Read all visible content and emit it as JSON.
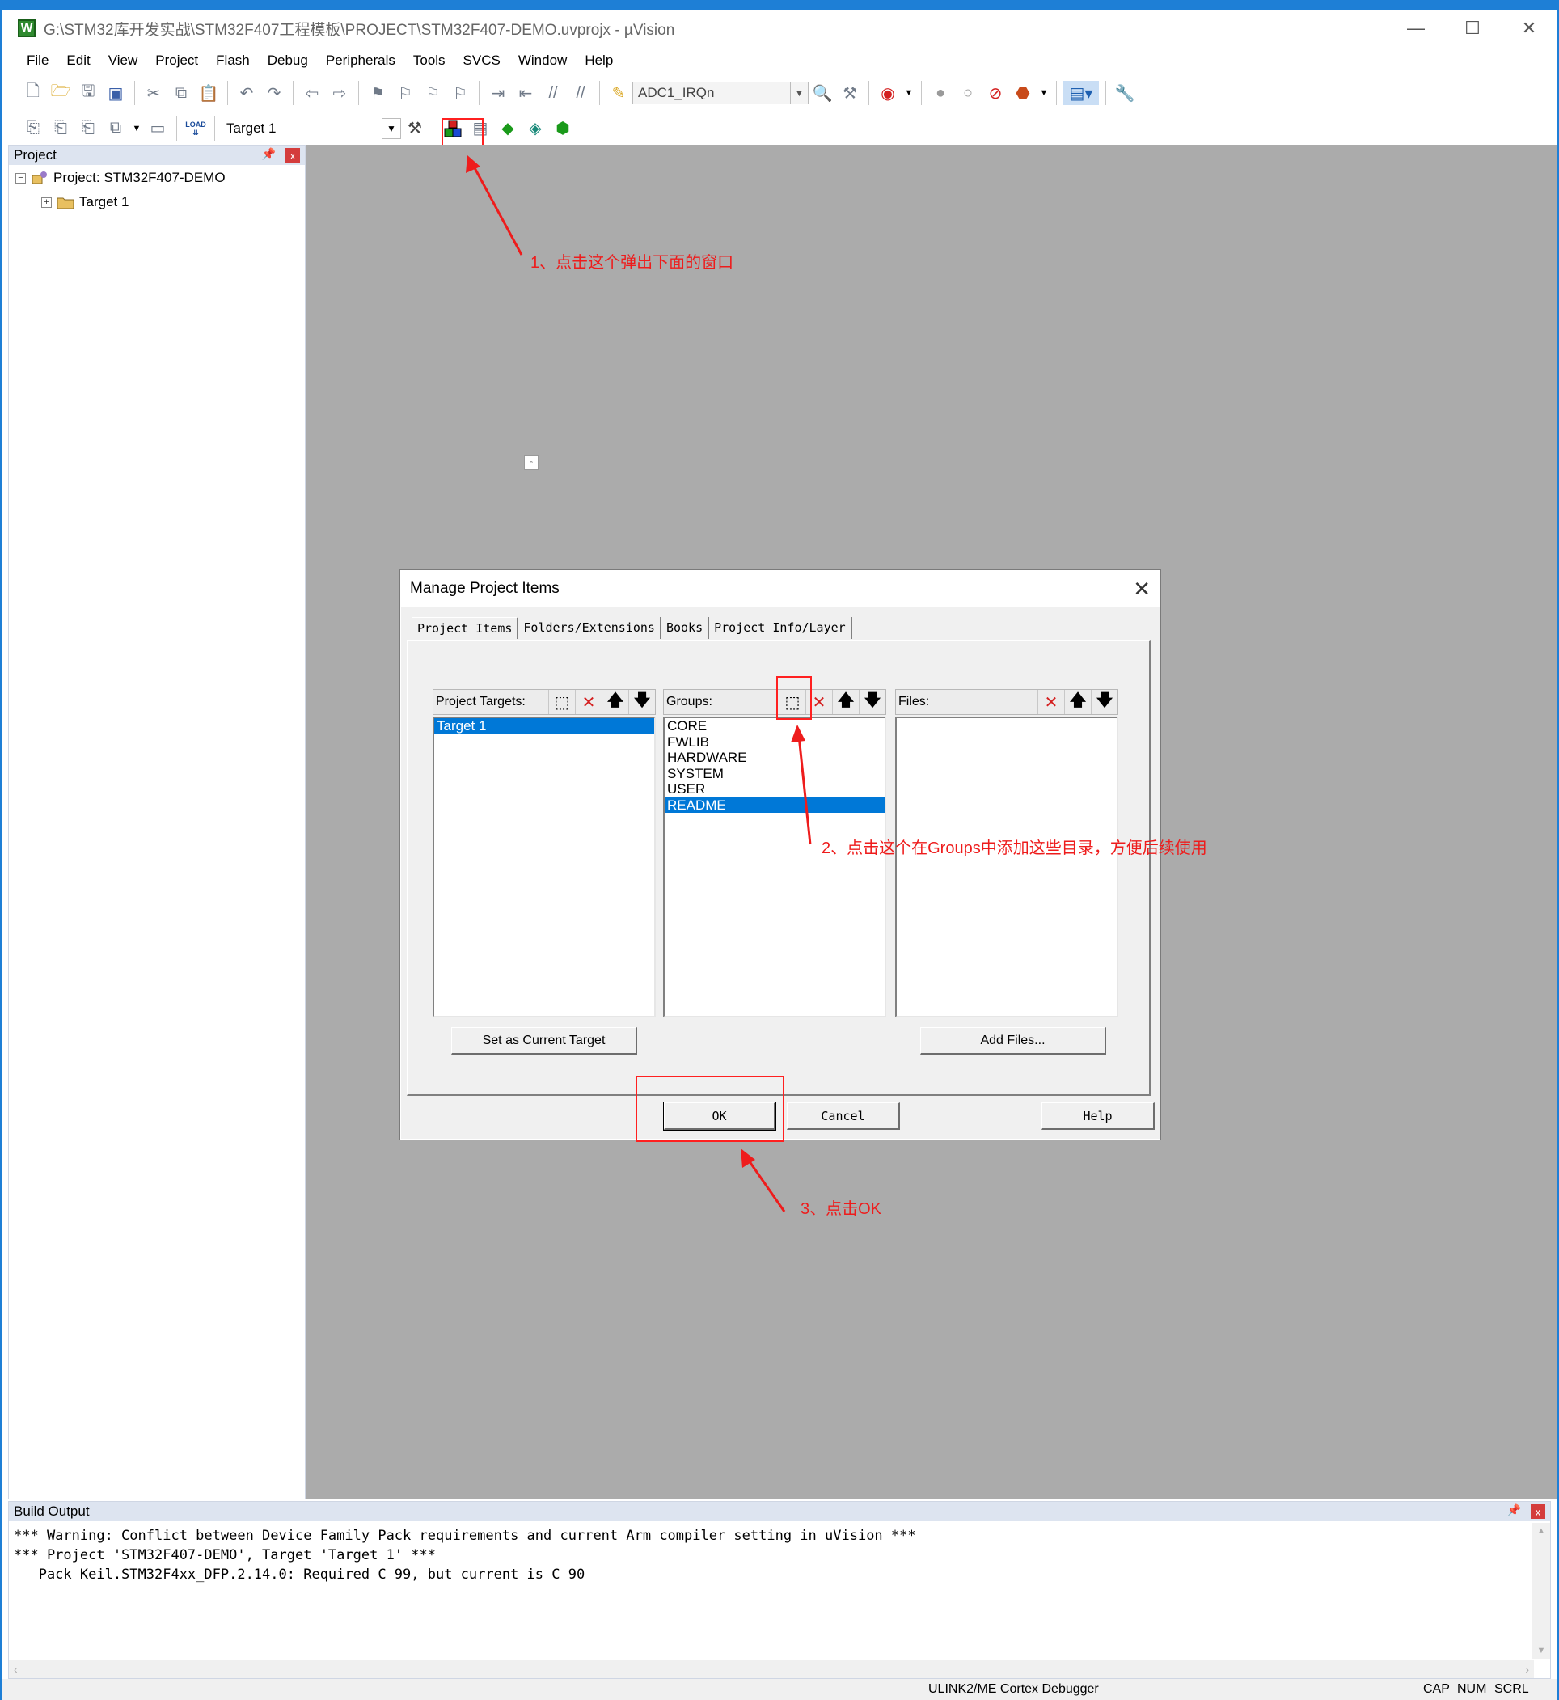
{
  "window": {
    "title": "G:\\STM32库开发实战\\STM32F407工程模板\\PROJECT\\STM32F407-DEMO.uvprojx - µVision",
    "app_icon_letter": "W",
    "minimize": "—",
    "maximize": "☐",
    "close": "✕"
  },
  "menu": [
    "File",
    "Edit",
    "View",
    "Project",
    "Flash",
    "Debug",
    "Peripherals",
    "Tools",
    "SVCS",
    "Window",
    "Help"
  ],
  "toolbar": {
    "function_combo": "ADC1_IRQn",
    "target_combo": "Target 1",
    "load_label": "LOAD"
  },
  "project_panel": {
    "header": "Project",
    "pin": "📌",
    "close": "x",
    "project_node": "Project: STM32F407-DEMO",
    "target_node": "Target 1",
    "expand_minus": "−",
    "expand_plus": "+"
  },
  "dialog": {
    "title": "Manage Project Items",
    "close": "✕",
    "tabs": [
      "Project Items",
      "Folders/Extensions",
      "Books",
      "Project Info/Layer"
    ],
    "targets_header": "Project Targets:",
    "groups_header": "Groups:",
    "files_header": "Files:",
    "targets": [
      "Target 1"
    ],
    "groups": [
      "CORE",
      "FWLIB",
      "HARDWARE",
      "SYSTEM",
      "USER",
      "README"
    ],
    "selected_group": "README",
    "set_current_target": "Set as Current Target",
    "add_files": "Add Files...",
    "ok": "OK",
    "cancel": "Cancel",
    "help": "Help",
    "icons": {
      "new": "⬚",
      "delete": "✕",
      "up": "🡅",
      "down": "🡇"
    }
  },
  "annotations": {
    "step1": "1、点击这个弹出下面的窗口",
    "step2": "2、点击这个在Groups中添加这些目录，方便后续使用",
    "step3": "3、点击OK",
    "color": "#ee1c1c"
  },
  "build_output": {
    "header": "Build Output",
    "lines": [
      "*** Warning: Conflict between Device Family Pack requirements and current Arm compiler setting in uVision ***",
      "*** Project 'STM32F407-DEMO', Target 'Target 1' ***",
      "   Pack Keil.STM32F4xx_DFP.2.14.0: Required C 99, but current is C 90"
    ]
  },
  "status": {
    "debugger": "ULINK2/ME Cortex Debugger",
    "cap": "CAP",
    "num": "NUM",
    "scrl": "SCRL"
  }
}
